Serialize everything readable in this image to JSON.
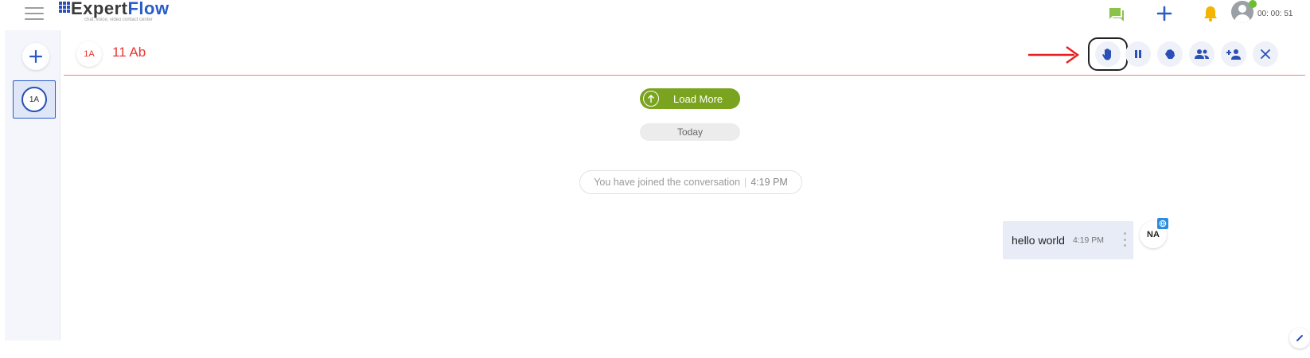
{
  "app": {
    "logo_prefix": "Expert",
    "logo_suffix": "Flow",
    "tagline": "chat, voice, video contact center"
  },
  "topbar": {
    "timer": "00: 00: 51",
    "icons": [
      "menu-icon",
      "chat-icon",
      "plus-icon",
      "bell-icon",
      "user-icon"
    ]
  },
  "rail": {
    "active_chat_initials": "1A"
  },
  "conversation": {
    "avatar_initials": "1A",
    "customer_name": "11 Ab",
    "toolbar_icons": [
      "raise-hand-icon",
      "pause-icon",
      "hand-icon",
      "group-icon",
      "add-person-icon",
      "close-icon"
    ]
  },
  "chat": {
    "load_more_label": "Load More",
    "date_divider": "Today",
    "system_message": "You have joined the conversation",
    "system_message_time": "4:19 PM",
    "messages": [
      {
        "text": "hello world",
        "time": "4:19 PM",
        "sender_initials": "NA"
      }
    ]
  },
  "colors": {
    "brand_blue": "#2a5cc8",
    "header_red": "#e53935",
    "load_more_green": "#7aa31f",
    "chat_icon_green": "#8bc34a",
    "bell_yellow": "#f4b400"
  }
}
